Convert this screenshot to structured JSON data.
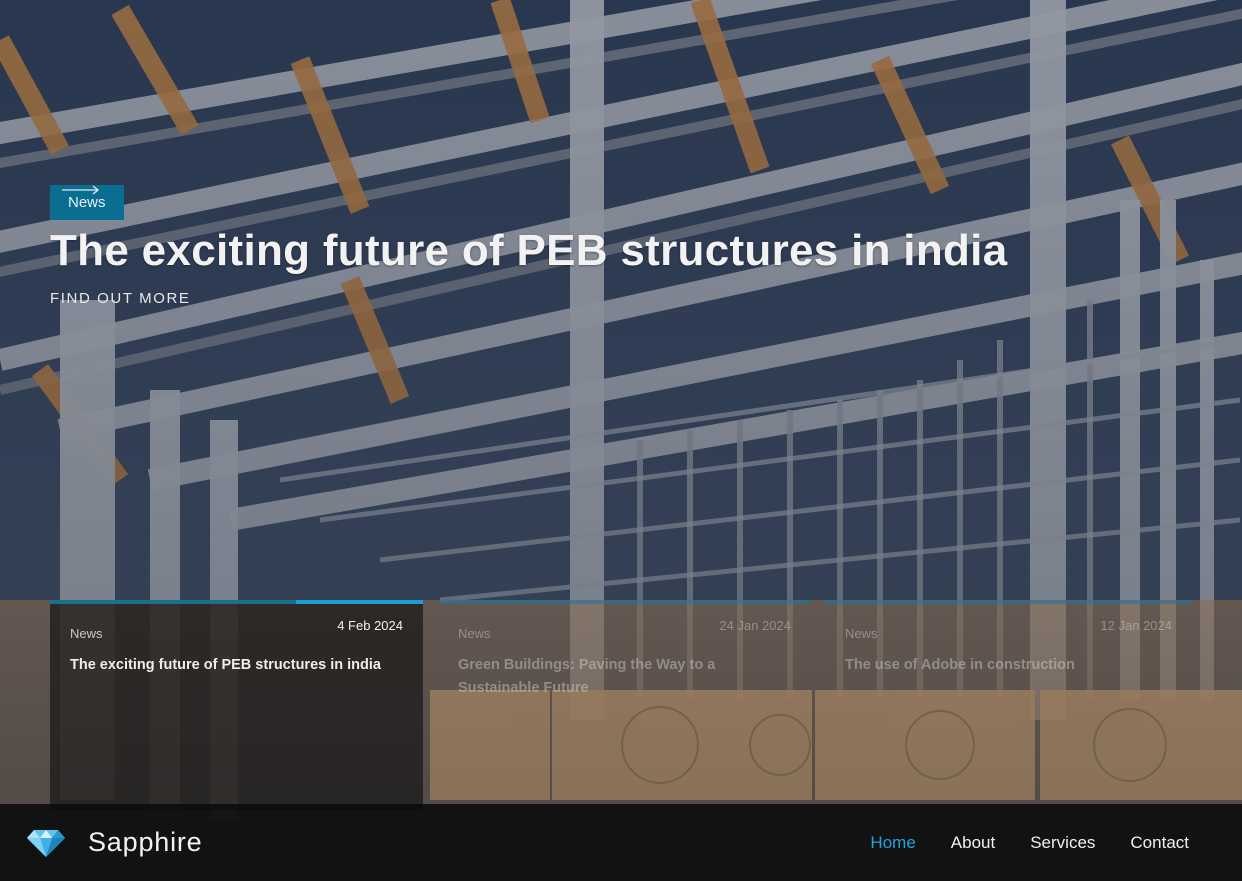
{
  "hero": {
    "tag": "News",
    "headline": "The exciting future of PEB structures in india",
    "cta_label": "FIND OUT MORE",
    "cta_icon": "arrow-right-icon"
  },
  "cards": [
    {
      "category": "News",
      "date": "4 Feb 2024",
      "title": "The exciting future of PEB structures in india",
      "active": true
    },
    {
      "category": "News",
      "date": "24 Jan 2024",
      "title": "Green Buildings: Paving the Way to a Sustainable Future",
      "active": false
    },
    {
      "category": "News",
      "date": "12 Jan 2024",
      "title": "The use of Adobe in construction",
      "active": false
    }
  ],
  "nav": {
    "brand": "Sapphire",
    "logo_icon": "diamond-icon",
    "items": [
      {
        "label": "Home",
        "current": true
      },
      {
        "label": "About",
        "current": false
      },
      {
        "label": "Services",
        "current": false
      },
      {
        "label": "Contact",
        "current": false
      }
    ]
  },
  "colors": {
    "accent": "#1ea6dd",
    "tag_bg": "#0a6e93",
    "nav_bg": "#0c0c0c"
  }
}
